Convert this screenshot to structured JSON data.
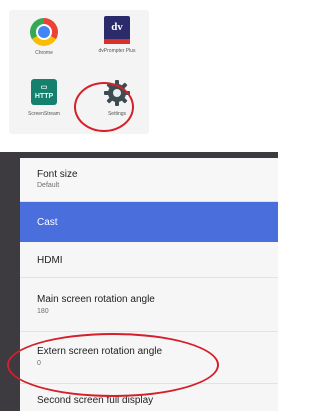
{
  "launcher": {
    "apps": [
      {
        "label": "Chrome",
        "icon": "chrome-icon"
      },
      {
        "label": "dvPrompter Plus",
        "icon": "dvprompter-icon",
        "icon_text": "dv"
      },
      {
        "label": "ScreenStream",
        "icon": "screenstream-icon",
        "icon_text": "HTTP"
      },
      {
        "label": "Settings",
        "icon": "gear-icon"
      }
    ]
  },
  "settings": {
    "rows": [
      {
        "title": "Font size",
        "subtitle": "Default"
      },
      {
        "title": "Cast"
      },
      {
        "title": "HDMI"
      },
      {
        "title": "Main screen rotation angle",
        "subtitle": "180"
      },
      {
        "title": "Extern screen rotation angle",
        "subtitle": "0"
      },
      {
        "title": "Second screen full display"
      }
    ]
  },
  "colors": {
    "highlight": "#4a6fdc",
    "annotation": "#d4202a",
    "screenstream": "#16806f",
    "dvprompter": "#2b2b6b"
  }
}
